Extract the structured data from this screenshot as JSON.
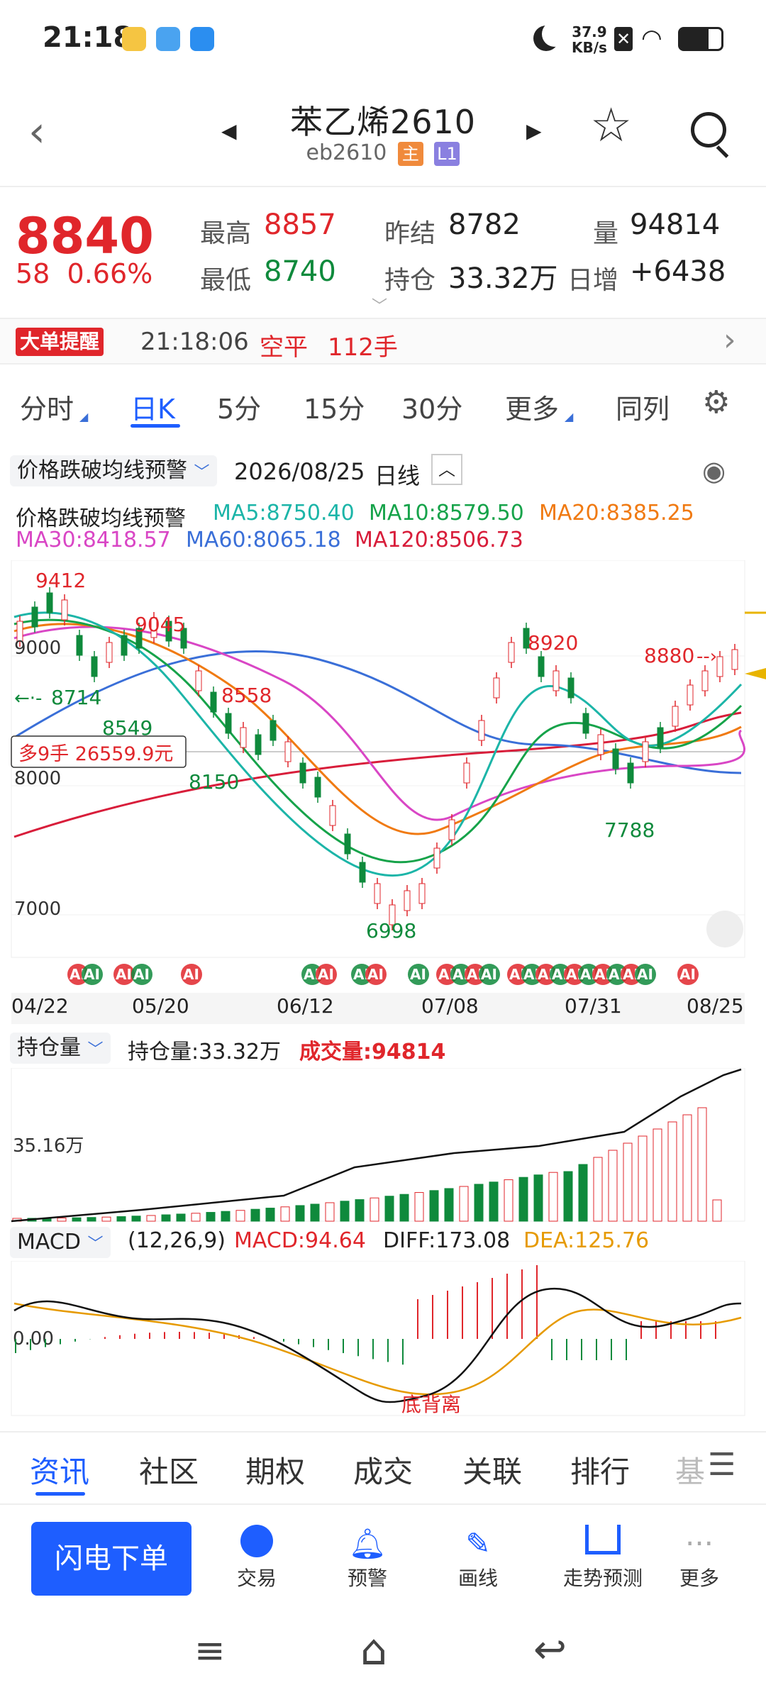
{
  "status": {
    "time": "21:18",
    "speed": "37.9",
    "speed_unit": "KB/s"
  },
  "header": {
    "title": "苯乙烯2610",
    "code": "eb2610",
    "tag_main": "主",
    "tag_l1": "L1"
  },
  "quote": {
    "price": "8840",
    "change": "58",
    "change_pct": "0.66%",
    "high_label": "最高",
    "high": "8857",
    "low_label": "最低",
    "low": "8740",
    "settle_label": "昨结",
    "settle": "8782",
    "oi_label": "持仓",
    "oi": "33.32万",
    "vol_label": "量",
    "vol": "94814",
    "daily_label": "日增",
    "daily": "+6438"
  },
  "alert": {
    "badge": "大单提醒",
    "time": "21:18:06",
    "type": "空平",
    "qty": "112手"
  },
  "tabs": [
    "分时",
    "日K",
    "5分",
    "15分",
    "30分",
    "更多",
    "同列"
  ],
  "indicator": {
    "name": "价格跌破均线预警",
    "date": "2026/08/25",
    "period": "日线"
  },
  "ma": {
    "title": "价格跌破均线预警",
    "ma5": "MA5:8750.40",
    "ma10": "MA10:8579.50",
    "ma20": "MA20:8385.25",
    "ma30": "MA30:8418.57",
    "ma60": "MA60:8065.18",
    "ma120": "MA120:8506.73"
  },
  "kchart": {
    "labels": {
      "high1": "9412",
      "high2": "9045",
      "low1": "8714",
      "low2": "8549",
      "low3": "8558",
      "low4": "8150",
      "low5": "6998",
      "high3": "8920",
      "high4": "8880",
      "low6": "7788"
    },
    "ticks": [
      "9000",
      "8000",
      "7000"
    ],
    "position_tag": "多9手  26559.9元",
    "dates": [
      "04/22",
      "05/20",
      "06/12",
      "07/08",
      "07/31",
      "08/25"
    ],
    "ai_label": "AI"
  },
  "oi_panel": {
    "select": "持仓量",
    "oi": "持仓量:33.32万",
    "vol": "成交量:94814",
    "tick": "35.16万"
  },
  "macd_panel": {
    "select": "MACD",
    "params": "(12,26,9)",
    "macd": "MACD:94.64",
    "diff": "DIFF:173.08",
    "dea": "DEA:125.76",
    "tick": "0.00",
    "divergence": "底背离"
  },
  "bottom_tabs": [
    "资讯",
    "社区",
    "期权",
    "成交",
    "关联",
    "排行",
    "基"
  ],
  "actions": {
    "primary": "闪电下单",
    "items": [
      "交易",
      "预警",
      "画线",
      "走势预测",
      "更多"
    ]
  },
  "colors": {
    "up": "#e0262b",
    "down": "#0f8a3c",
    "accent": "#1e5eff",
    "ma5": "#1cb5a8",
    "ma10": "#16a34a",
    "ma20": "#f07a12",
    "ma30": "#d946c5",
    "ma60": "#3a6fd8",
    "ma120": "#d81d3a"
  }
}
